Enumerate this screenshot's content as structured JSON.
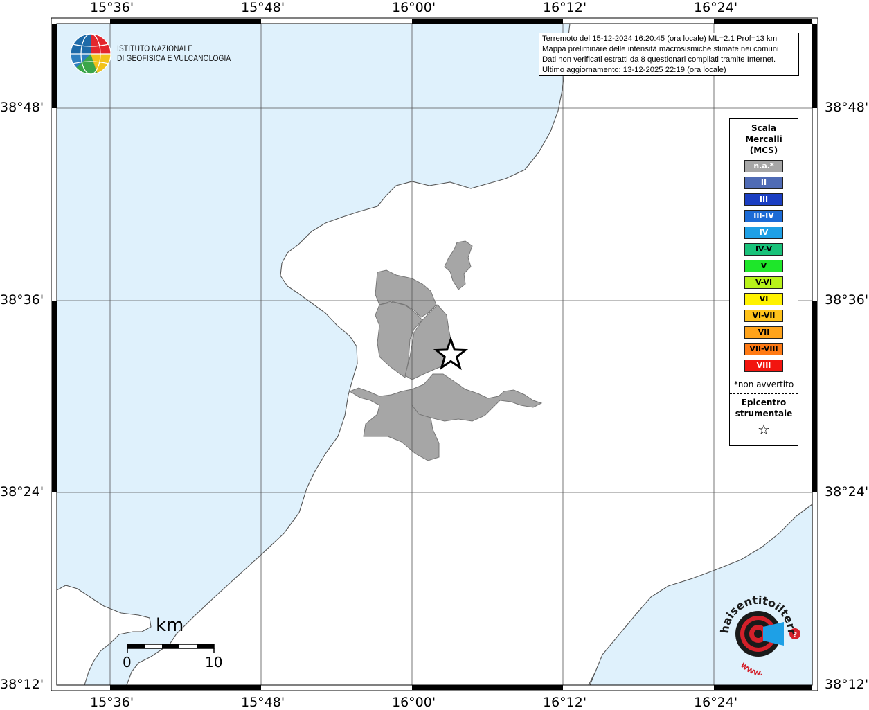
{
  "map": {
    "tick_labels": {
      "lon": [
        "15°36'",
        "15°48'",
        "16°00'",
        "16°12'",
        "16°24'"
      ],
      "lat": [
        "38°48'",
        "38°36'",
        "38°24'",
        "38°12'"
      ]
    },
    "colors": {
      "sea": "#dff1fc",
      "land": "#ffffff",
      "municipality_fill": "#a6a6a6",
      "coastline": "#555555"
    },
    "epicenter_symbol": "star-icon"
  },
  "info": {
    "line1": "Terremoto del 15-12-2024 16:20:45 (ora locale) ML=2.1 Prof=13 km",
    "line2": "Mappa preliminare delle intensità macrosismiche stimate nei comuni",
    "line3": "Dati non verificati estratti da 8 questionari compilati tramite Internet.",
    "line4": "Ultimo aggiornamento: 13-12-2025 22:19 (ora locale)"
  },
  "logo": {
    "line1": "ISTITUTO NAZIONALE",
    "line2": "DI GEOFISICA E VULCANOLOGIA"
  },
  "legend": {
    "title1": "Scala",
    "title2": "Mercalli",
    "title3": "(MCS)",
    "items": [
      {
        "label": "n.a.*",
        "color": "#a6a6a6",
        "text_color": "#ffffff"
      },
      {
        "label": "II",
        "color": "#4f6bb5",
        "text_color": "#ffffff"
      },
      {
        "label": "III",
        "color": "#1a3ec2",
        "text_color": "#ffffff"
      },
      {
        "label": "III-IV",
        "color": "#1c6bd6",
        "text_color": "#ffffff"
      },
      {
        "label": "IV",
        "color": "#1ea0e6",
        "text_color": "#ffffff"
      },
      {
        "label": "IV-V",
        "color": "#19c27a",
        "text_color": "#000000"
      },
      {
        "label": "V",
        "color": "#1ee62a",
        "text_color": "#000000"
      },
      {
        "label": "V-VI",
        "color": "#b8f21a",
        "text_color": "#000000"
      },
      {
        "label": "VI",
        "color": "#fff200",
        "text_color": "#000000"
      },
      {
        "label": "VI-VII",
        "color": "#ffc21a",
        "text_color": "#000000"
      },
      {
        "label": "VII",
        "color": "#ffa31a",
        "text_color": "#000000"
      },
      {
        "label": "VII-VIII",
        "color": "#ff7a14",
        "text_color": "#000000"
      },
      {
        "label": "VIII",
        "color": "#f2150f",
        "text_color": "#ffffff"
      }
    ],
    "note": "*non avvertito",
    "epicenter1": "Epicentro",
    "epicenter2": "strumentale",
    "star": "☆"
  },
  "scalebar": {
    "unit": "km",
    "min": "0",
    "max": "10"
  },
  "watermark": {
    "text_main": "haisentitoilterremoto",
    "text_domain": ".it",
    "text_www": "www."
  }
}
